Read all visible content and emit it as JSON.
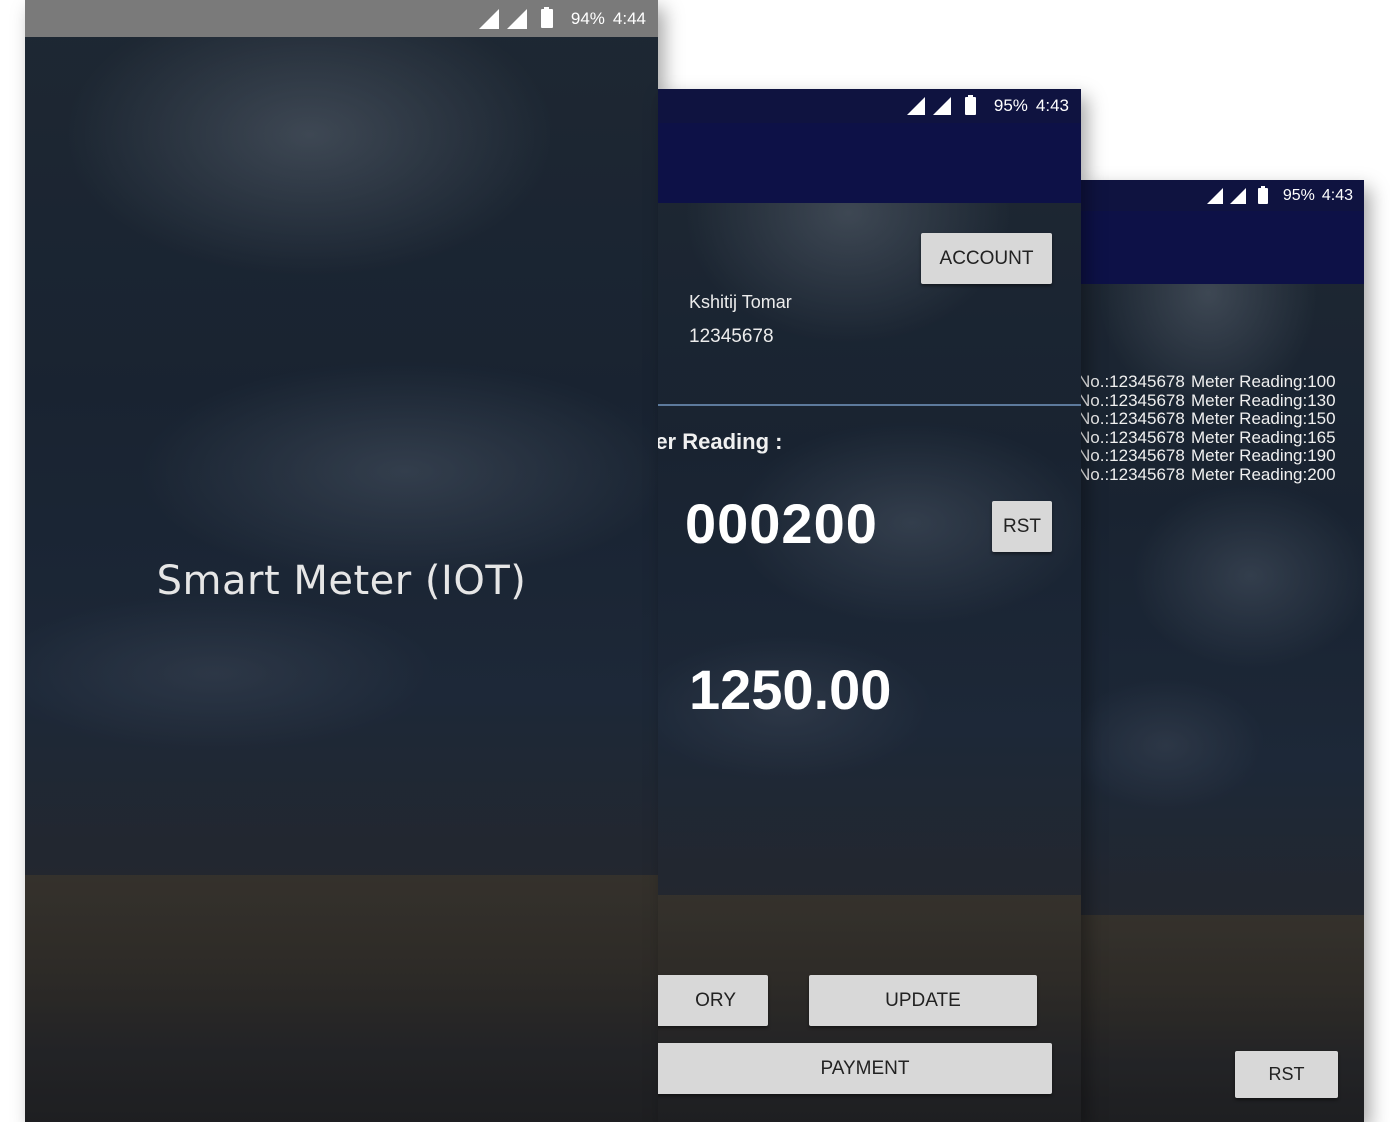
{
  "screen1": {
    "status": {
      "battery": "94%",
      "time": "4:44"
    },
    "title": "Smart Meter (IOT)"
  },
  "screen2": {
    "status": {
      "battery": "95%",
      "time": "4:43"
    },
    "account_button": "ACCOUNT",
    "user_name": "Kshitij Tomar",
    "account_number": "12345678",
    "meter_reading_label": "ter Reading  :",
    "meter_reading_value": "000200",
    "rst_button": "RST",
    "amount": "1250.00",
    "history_button_partial": "ORY",
    "update_button": "UPDATE",
    "payment_button": "PAYMENT"
  },
  "screen3": {
    "status": {
      "battery": "95%",
      "time": "4:43"
    },
    "history": [
      {
        "meter": "No.:12345678",
        "reading": "Meter Reading:100"
      },
      {
        "meter": "No.:12345678",
        "reading": "Meter Reading:130"
      },
      {
        "meter": "No.:12345678",
        "reading": "Meter Reading:150"
      },
      {
        "meter": "No.:12345678",
        "reading": "Meter Reading:165"
      },
      {
        "meter": "No.:12345678",
        "reading": "Meter Reading:190"
      },
      {
        "meter": "No.:12345678",
        "reading": "Meter Reading:200"
      }
    ],
    "rst_button": "RST"
  },
  "icons": [
    "signal-icon",
    "signal-icon",
    "battery-icon"
  ],
  "colors": {
    "app_bar": "#0d1147",
    "status_bar_dark": "#0f1340",
    "status_bar_gray": "#7a7a7a",
    "button": "#d8d8d8"
  }
}
